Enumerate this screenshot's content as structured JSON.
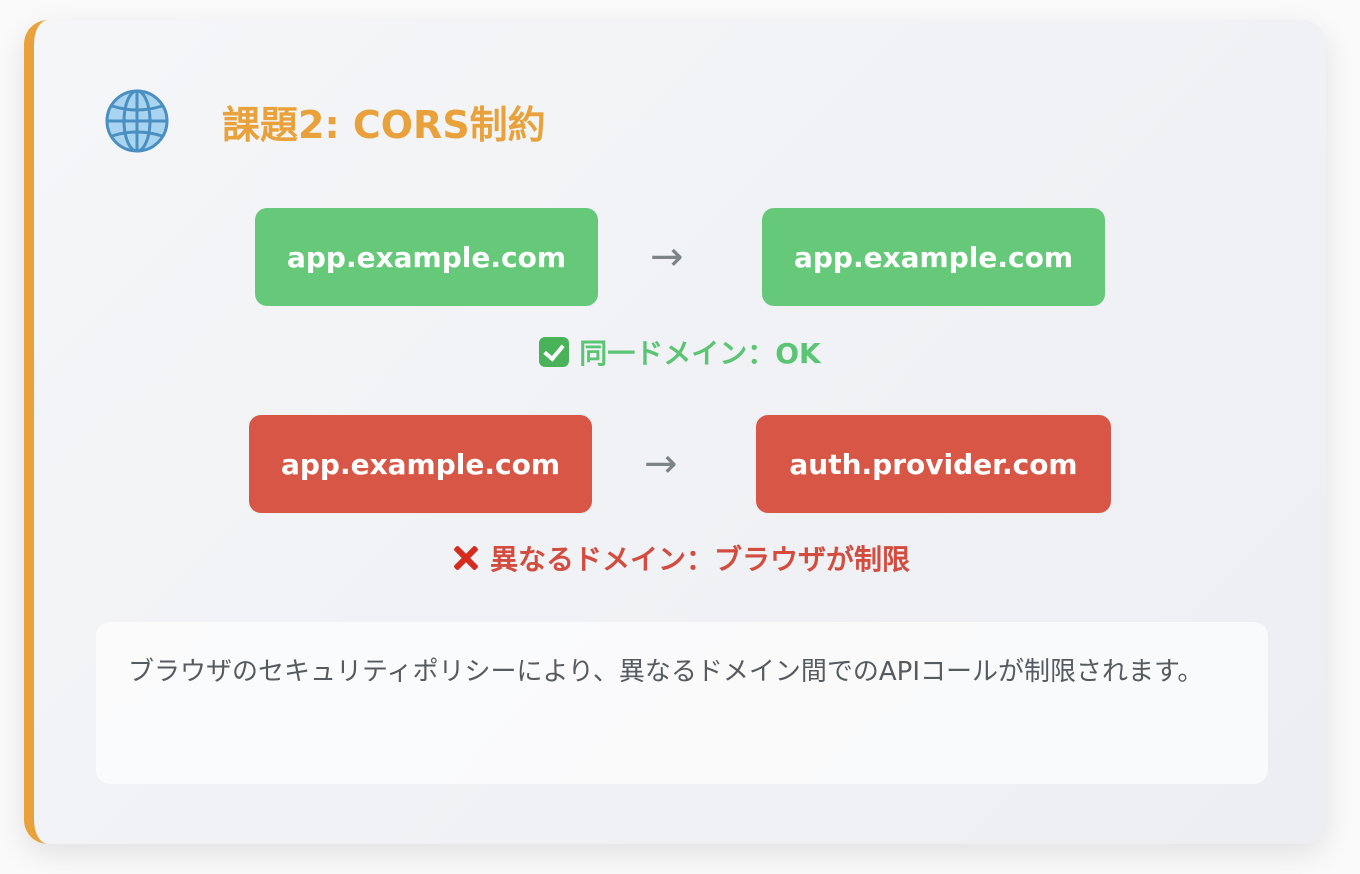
{
  "header": {
    "icon": "globe-icon",
    "title": "課題2: CORS制約"
  },
  "same_domain": {
    "from": "app.example.com",
    "arrow": "→",
    "to": "app.example.com",
    "status_icon": "check-icon",
    "status": "同一ドメイン：OK",
    "color": "#66c97a"
  },
  "cross_domain": {
    "from": "app.example.com",
    "arrow": "→",
    "to": "auth.provider.com",
    "status_icon": "cross-icon",
    "status": "異なるドメイン：ブラウザが制限",
    "color": "#d75646"
  },
  "description": "ブラウザのセキュリティポリシーにより、異なるドメイン間でのAPIコールが制限されます。",
  "accent_color": "#e9a23b"
}
